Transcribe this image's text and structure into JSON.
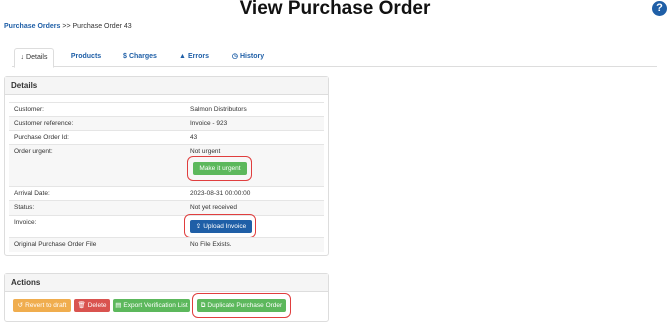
{
  "page": {
    "title": "View Purchase Order",
    "help": "?"
  },
  "breadcrumb": {
    "link": "Purchase Orders",
    "separator": ">>",
    "current": "Purchase Order 43"
  },
  "tabs": [
    {
      "icon": "↓",
      "label": "Details"
    },
    {
      "icon": "",
      "label": "Products"
    },
    {
      "icon": "$",
      "label": "Charges"
    },
    {
      "icon": "▲",
      "label": "Errors"
    },
    {
      "icon": "◷",
      "label": "History"
    }
  ],
  "details": {
    "heading": "Details",
    "rows": [
      {
        "label": "Customer:",
        "value": "Salmon Distributors"
      },
      {
        "label": "Customer reference:",
        "value": "Invoice - 923"
      },
      {
        "label": "Purchase Order Id:",
        "value": "43"
      },
      {
        "label": "Order urgent:",
        "value": "Not urgent"
      },
      {
        "label": "Arrival Date:",
        "value": "2023-08-31 00:00:00"
      },
      {
        "label": "Status:",
        "value": "Not yet received"
      },
      {
        "label": "Invoice:",
        "value": ""
      },
      {
        "label": "Original Purchase Order File",
        "value": "No File Exists."
      }
    ],
    "make_urgent_label": "Make it urgent",
    "upload_invoice_label": "Upload Invoice"
  },
  "actions": {
    "heading": "Actions",
    "revert_label": "Revert to draft",
    "delete_label": "Delete",
    "export_label": "Export Verification List",
    "duplicate_label": "Duplicate Purchase Order"
  }
}
